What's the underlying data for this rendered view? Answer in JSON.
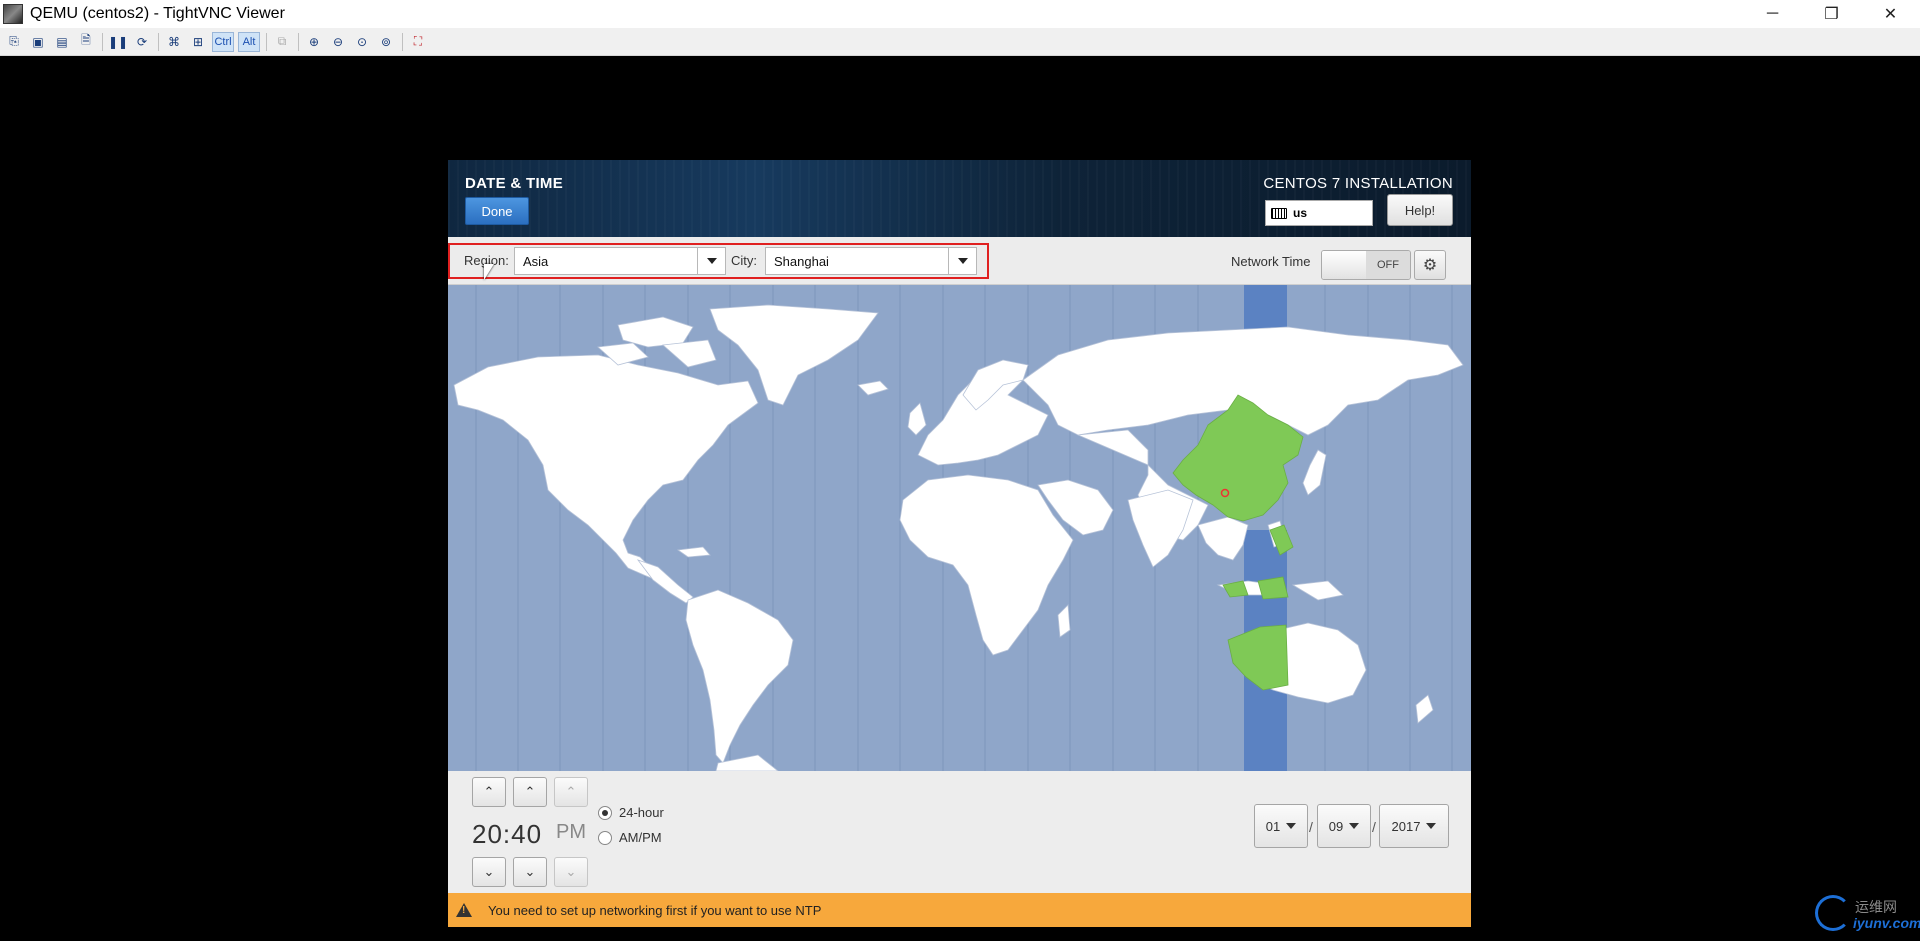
{
  "window": {
    "title": "QEMU (centos2) - TightVNC Viewer",
    "minimize": "─",
    "restore": "❐",
    "close": "✕"
  },
  "toolbar": {
    "ctrl_label": "Ctrl",
    "alt_label": "Alt"
  },
  "installer": {
    "page_title": "DATE & TIME",
    "done_label": "Done",
    "product_title": "CENTOS 7 INSTALLATION",
    "keyboard_layout": "us",
    "help_label": "Help!"
  },
  "selection": {
    "region_label": "Region:",
    "region_value": "Asia",
    "city_label": "City:",
    "city_value": "Shanghai",
    "network_time_label": "Network Time",
    "network_time_state": "OFF"
  },
  "time": {
    "value": "20:40",
    "ampm": "PM",
    "format_24h_label": "24-hour",
    "format_ampm_label": "AM/PM",
    "selected_format": "24-hour"
  },
  "date": {
    "month": "01",
    "day": "09",
    "year": "2017",
    "separator": "/"
  },
  "warning": {
    "text": "You need to set up networking first if you want to use NTP"
  },
  "watermark": {
    "cn": "运维网",
    "en": "iyunv.com"
  },
  "colors": {
    "ocean": "#8fa6c9",
    "land": "#ffffff",
    "selected_zone": "#7fc956",
    "zone_band": "#5b82c2",
    "warning": "#f7a83c",
    "highlight_box": "#e02020"
  }
}
